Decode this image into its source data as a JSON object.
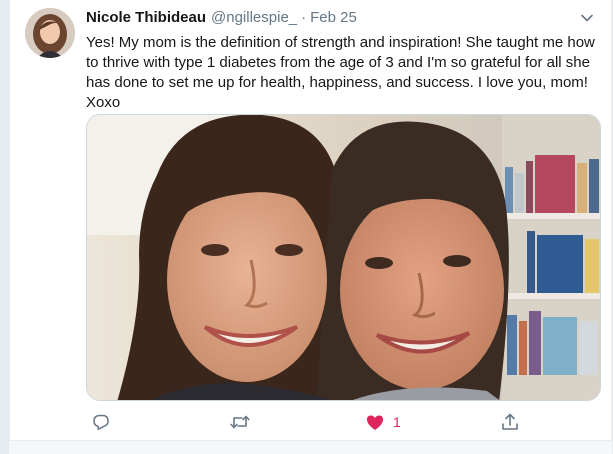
{
  "tweet": {
    "author": {
      "display_name": "Nicole Thibideau",
      "handle": "@ngillespie_",
      "avatar_icon": "profile-photo"
    },
    "separator": "·",
    "timestamp": "Feb 25",
    "text": "Yes! My mom is the definition of strength and inspiration! She taught me how to thrive with type 1 diabetes from the age of 3 and I'm so grateful for all she has done to set me up for health, happiness, and success. I love you, mom! Xoxo",
    "media": {
      "icon": "photo-two-women-selfie"
    },
    "actions": {
      "reply": {
        "icon": "reply-icon",
        "count": ""
      },
      "retweet": {
        "icon": "retweet-icon",
        "count": ""
      },
      "like": {
        "icon": "heart-icon",
        "count": "1",
        "liked": true,
        "color": "#e0245e"
      },
      "share": {
        "icon": "share-icon"
      }
    }
  },
  "colors": {
    "text": "#14171a",
    "secondary": "#657786",
    "like": "#e0245e",
    "background": "#e6ecf0"
  }
}
